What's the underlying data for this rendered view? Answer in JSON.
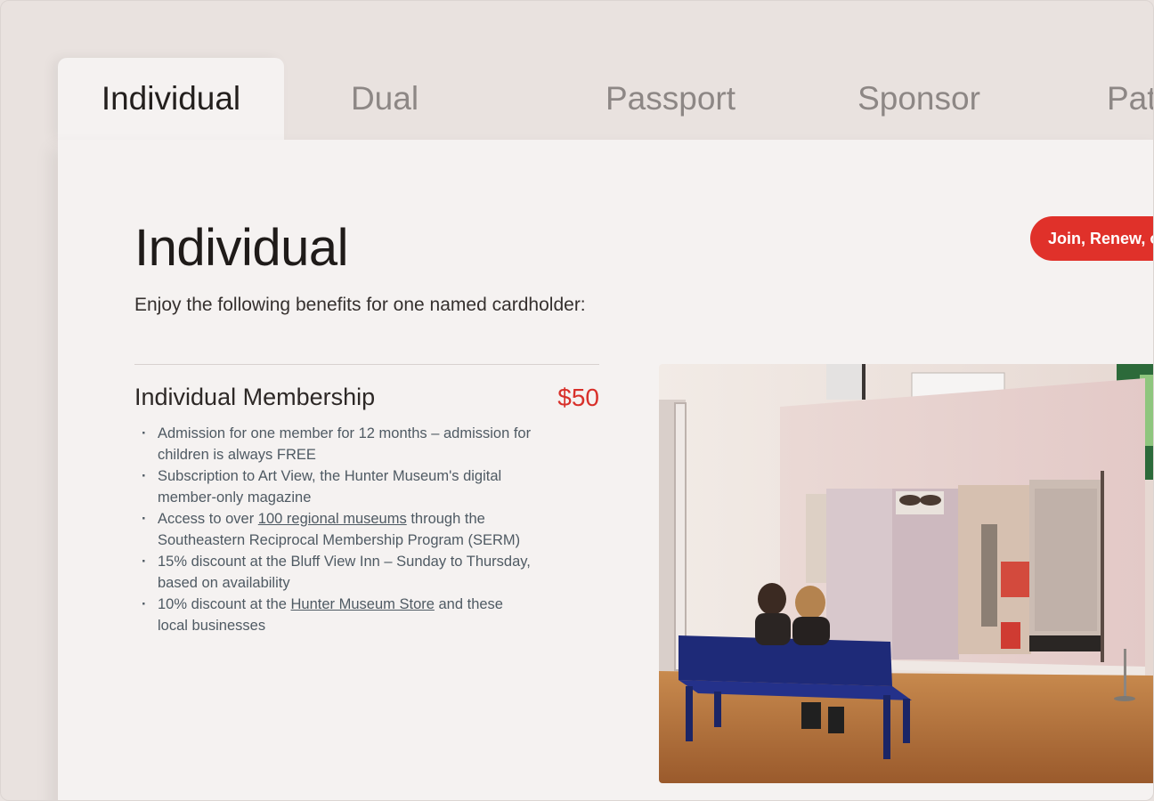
{
  "tabs": [
    {
      "label": "Individual",
      "active": true
    },
    {
      "label": "Dual",
      "active": false
    },
    {
      "label": "Passport",
      "active": false
    },
    {
      "label": "Sponsor",
      "active": false
    },
    {
      "label": "Pat",
      "active": false
    }
  ],
  "panel": {
    "title": "Individual",
    "intro": "Enjoy the following benefits for one named cardholder:",
    "cta_label": "Join, Renew, o"
  },
  "tier": {
    "name": "Individual Membership",
    "price": "$50",
    "benefits": [
      {
        "pre": "Admission for one member for 12 months – admission for children is always FREE"
      },
      {
        "pre": "Subscription to Art View, the Hunter Museum's digital member-only magazine"
      },
      {
        "pre": "Access to over ",
        "link": "100 regional museums",
        "post": " through the Southeastern Reciprocal Membership Program (SERM)"
      },
      {
        "pre": "15% discount at the Bluff View Inn – Sunday to Thursday, based on availability"
      },
      {
        "pre": "10% discount at the ",
        "link": "Hunter Museum Store",
        "post": " and these local businesses"
      }
    ]
  },
  "colors": {
    "accent": "#e0312a",
    "price": "#d8302a",
    "panel_bg": "#f5f2f1",
    "page_bg": "#e9e2df"
  },
  "image": {
    "subject": "gallery-photo"
  }
}
